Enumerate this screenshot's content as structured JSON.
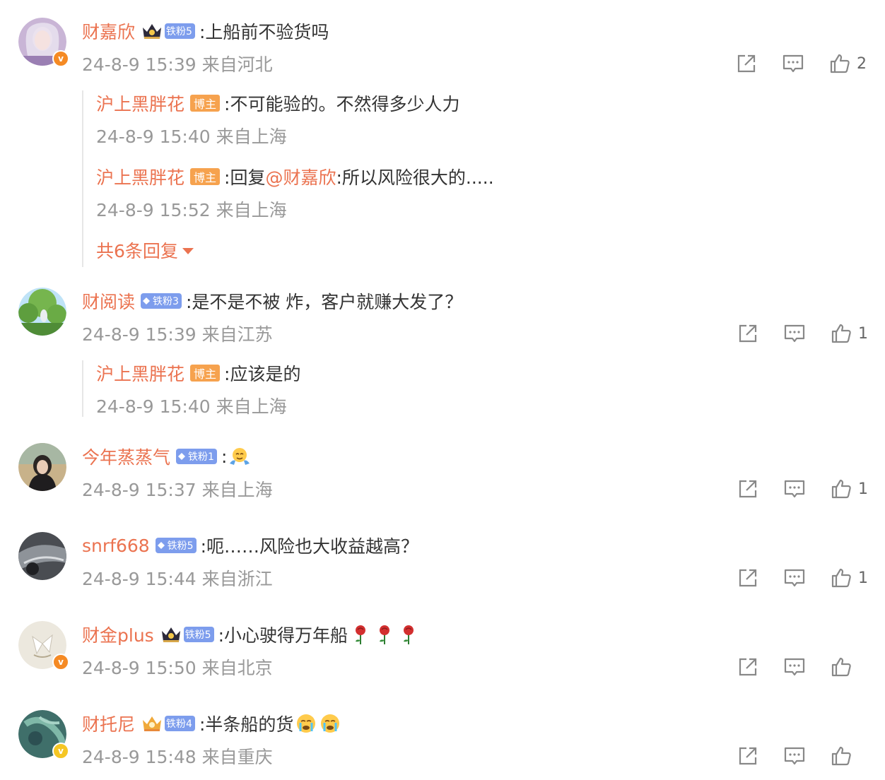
{
  "colors": {
    "name": "#eb7350",
    "meta": "#999999",
    "text": "#333333",
    "host_badge": "#f6a24e",
    "fan_badge": "#7d9ded"
  },
  "comments": [
    {
      "user": "财嘉欣",
      "fan_label": "铁粉5",
      "text": ":上船前不验货吗",
      "meta": "24-8-9 15:39 来自河北",
      "likes": "2",
      "replies": [
        {
          "user": "沪上黑胖花",
          "badge": "博主",
          "text": ":不可能验的。不然得多少人力",
          "meta": "24-8-9 15:40 来自上海"
        },
        {
          "user": "沪上黑胖花",
          "badge": "博主",
          "prefix": ":回复",
          "mention": "@财嘉欣",
          "text": ":所以风险很大的.....",
          "meta": "24-8-9 15:52 来自上海"
        }
      ],
      "more_replies": "共6条回复"
    },
    {
      "user": "财阅读",
      "fan_label": "铁粉3",
      "text": ":是不是不被 炸，客户就赚大发了？",
      "meta": "24-8-9 15:39 来自江苏",
      "likes": "1",
      "replies": [
        {
          "user": "沪上黑胖花",
          "badge": "博主",
          "text": ":应该是的",
          "meta": "24-8-9 15:40 来自上海"
        }
      ]
    },
    {
      "user": "今年蒸蒸气",
      "fan_label": "铁粉1",
      "text": ":",
      "emoji": "shrug-emoji",
      "meta": "24-8-9 15:37 来自上海",
      "likes": "1"
    },
    {
      "user": "snrf668",
      "fan_label": "铁粉5",
      "text": ":呃……风险也大收益越高？",
      "meta": "24-8-9 15:44 来自浙江",
      "likes": "1"
    },
    {
      "user": "财金plus",
      "fan_label": "铁粉5",
      "text": ":小心驶得万年船",
      "emoji": "rose-emoji x3",
      "meta": "24-8-9 15:50 来自北京",
      "likes": ""
    },
    {
      "user": "财托尼",
      "fan_label": "铁粉4",
      "text": ":半条船的货",
      "emoji": "crying-emoji x2",
      "meta": "24-8-9 15:48 来自重庆",
      "likes": ""
    }
  ]
}
